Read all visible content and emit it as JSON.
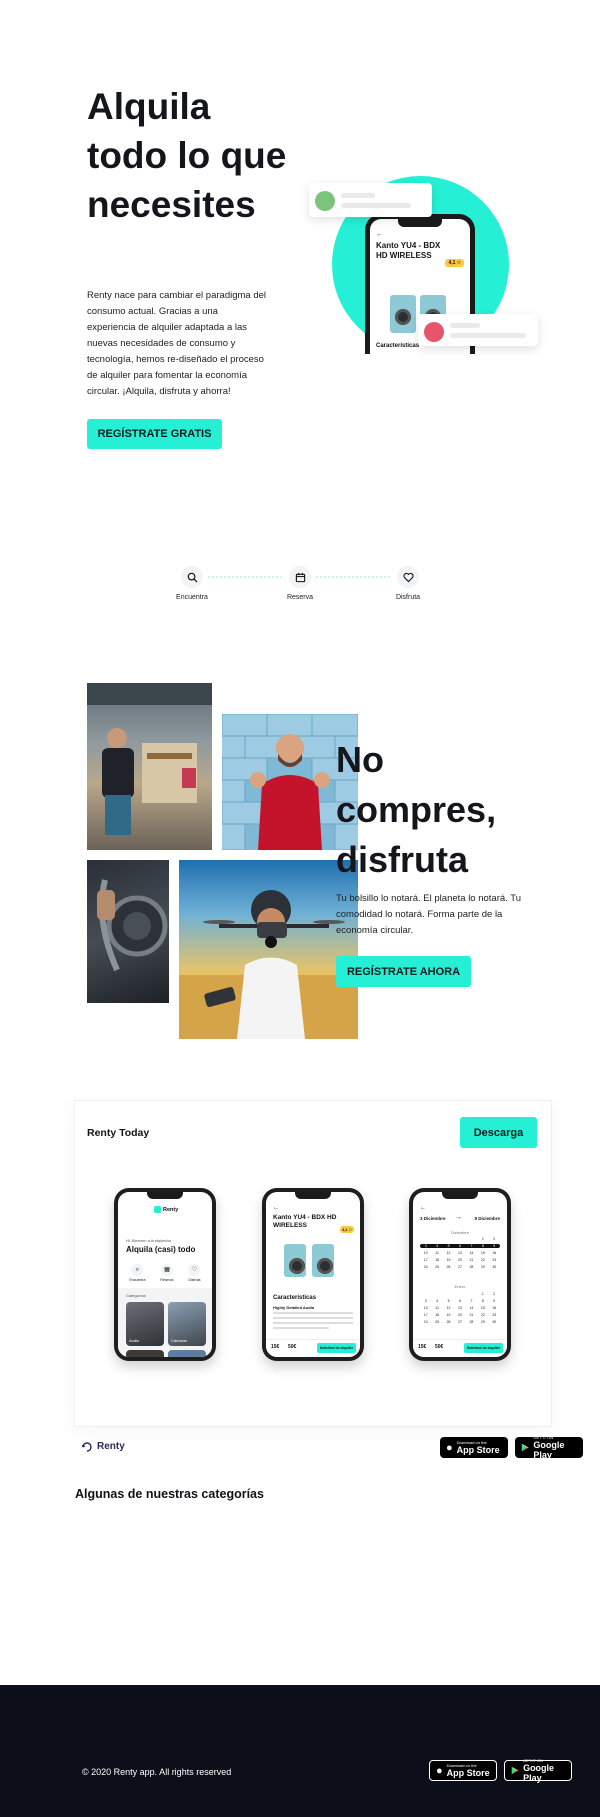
{
  "colors": {
    "accent": "#25f0d5",
    "dark": "#15161c",
    "footer": "#0c0e1a"
  },
  "hero": {
    "title": "Alquila todo lo que necesites",
    "description": "Renty nace para cambiar el paradigma del consumo actual. Gracias a una experiencia de alquiler adaptada a las nuevas necesidades de consumo y tecnología, hemos re-diseñado el proceso de alquiler para fomentar la economía circular. ¡Alquila, disfruta y ahorra!",
    "cta": "REGÍSTRATE GRATIS",
    "phone": {
      "product_title": "Kanto YU4 - BDX HD WIRELESS",
      "rating": "4,1 ✩",
      "section": "Características"
    }
  },
  "steps": [
    {
      "label": "Encuentra",
      "icon": "search-icon"
    },
    {
      "label": "Reserva",
      "icon": "calendar-icon"
    },
    {
      "label": "Disfruta",
      "icon": "heart-icon"
    }
  ],
  "section3": {
    "title": "No compres, disfruta",
    "description": "Tu bolsillo lo notará. El planeta lo notará. Tu comodidad lo notará. Forma parte de la economía circular.",
    "cta": "REGÍSTRATE AHORA"
  },
  "app": {
    "heading": "Renty Today",
    "download": "Descarga",
    "phone1": {
      "brand": "Renty",
      "greeting": "Hi, Bienven a Andalumba",
      "headline": "Alquila (casi) todo",
      "menu": [
        "Encuentra",
        "Reserva",
        "Disfruta"
      ],
      "categories": "Categorías",
      "cards": [
        "Audio",
        "Cámaras"
      ]
    },
    "phone2": {
      "title": "Kanto YU4 - BDX HD WIRELESS",
      "rating": "4,1 ✩",
      "section": "Características",
      "subhead": "Highly Detailed Audio",
      "price1": "15€",
      "price2": "50€",
      "button": "Solicitud de alquiler"
    },
    "phone3": {
      "from": "3 Diciembre",
      "to": "9 Diciembre",
      "month1": "Diciembre",
      "month2": "Enero",
      "price1": "15€",
      "price2": "50€",
      "button": "Solicitud de alquiler"
    }
  },
  "brand": {
    "name": "Renty"
  },
  "stores": {
    "apple": {
      "small": "Download on the",
      "big": "App Store"
    },
    "google": {
      "small": "GET IT ON",
      "big": "Google Play"
    }
  },
  "categories_title": "Algunas de nuestras categorías",
  "footer": {
    "copyright": "© 2020 Renty app. All rights reserved"
  }
}
